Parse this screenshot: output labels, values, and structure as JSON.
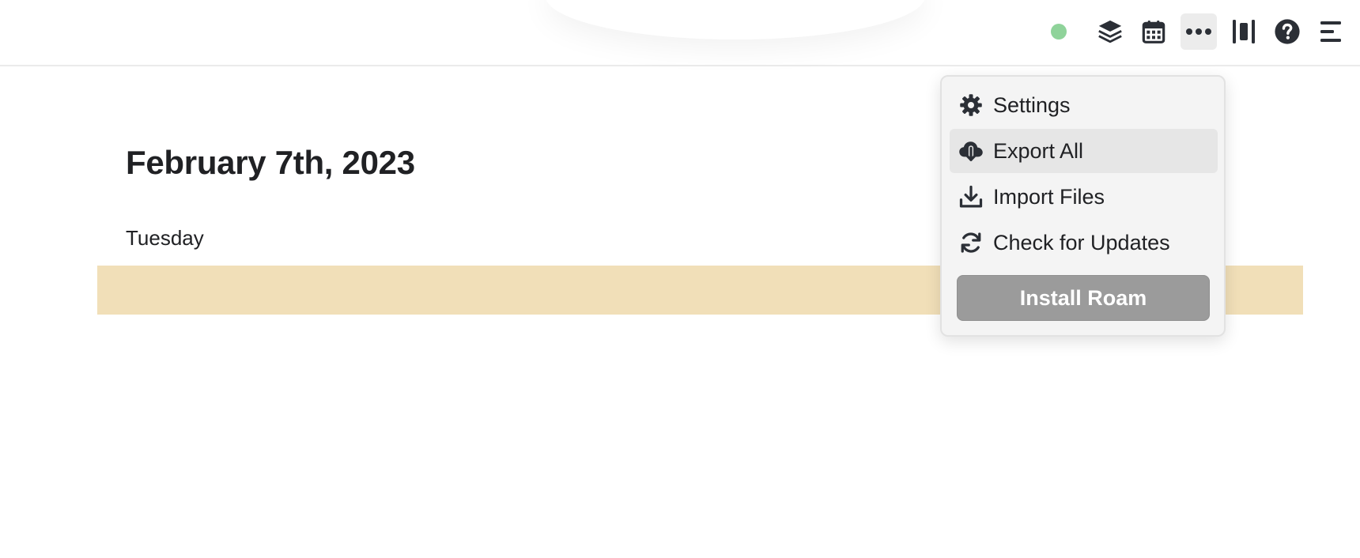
{
  "colors": {
    "sync_dot": "#8fd39a",
    "highlight_band": "#f1dfb8",
    "install_button_bg": "#9b9b9b",
    "icon": "#2b2f36"
  },
  "topbar": {
    "sync_status_icon": "green-dot",
    "buttons": [
      {
        "name": "layers-icon"
      },
      {
        "name": "calendar-icon"
      },
      {
        "name": "more-options-icon",
        "active": true
      },
      {
        "name": "sidebar-toggle-icon"
      },
      {
        "name": "help-icon"
      },
      {
        "name": "right-sidebar-icon"
      }
    ]
  },
  "page": {
    "title": "February 7th, 2023",
    "blocks": [
      "Tuesday"
    ]
  },
  "menu": {
    "items": [
      {
        "label": "Settings",
        "icon": "gear-icon"
      },
      {
        "label": "Export All",
        "icon": "cloud-download-icon",
        "hovered": true
      },
      {
        "label": "Import Files",
        "icon": "download-icon"
      },
      {
        "label": "Check for Updates",
        "icon": "refresh-icon"
      }
    ],
    "install_button_label": "Install Roam"
  }
}
